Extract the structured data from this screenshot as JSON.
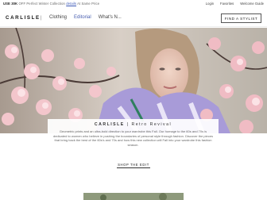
{
  "promo": {
    "prefix": "USE",
    "code": "30K",
    "text": "OFF Perfect Winter Collection",
    "link": "details",
    "suffix": "At Same Price"
  },
  "util_nav": [
    "Login",
    "Favorites",
    "Welcome Guide"
  ],
  "header": {
    "logo": "CARLISLE",
    "logo_sep": "|",
    "nav": [
      "Clothing",
      "Editorial",
      "What's N..."
    ],
    "stylist_button": "FIND A STYLIST"
  },
  "hero": {
    "card_title_brand": "CARLISLE",
    "card_title_rest": "| Retro Revival",
    "card_body": "Geometric prints and an ultra-bold direction to your wardrobe this Fall. Our homage to the 60s and 70s is dedicated to women who believe in pushing the boundaries of personal style through fashion. Discover the pieces that bring back the best of the 60s's and 70s and how this new collection will Fall into your wardrobe this fashion season.",
    "cta": "SHOP THE EDIT"
  },
  "colors": {
    "accent_link": "#4a5fb0",
    "petal_pink": "#f3c6cc",
    "skin": "#e8c8b8",
    "shirt_violet": "#a89bd8"
  }
}
